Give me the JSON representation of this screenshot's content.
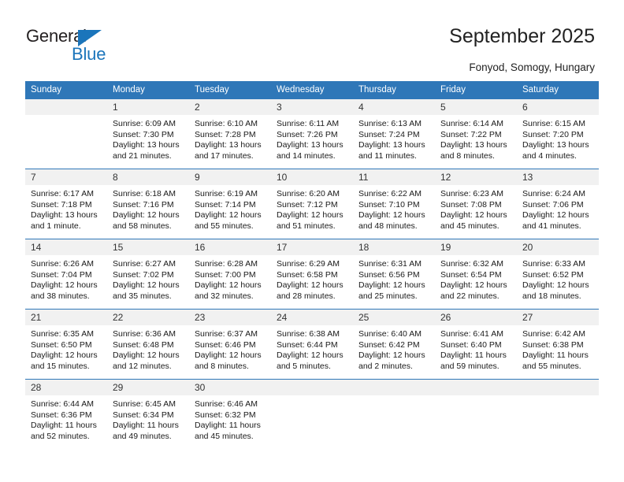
{
  "brand": {
    "name_part1": "General",
    "name_part2": "Blue",
    "triangle_color": "#1b75bb",
    "text_color": "#231f20"
  },
  "header": {
    "title": "September 2025",
    "subtitle": "Fonyod, Somogy, Hungary"
  },
  "theme": {
    "header_blue": "#2f77b8",
    "daynum_band": "#f1f1f1",
    "text": "#1a1a1a"
  },
  "weekday_headers": [
    "Sunday",
    "Monday",
    "Tuesday",
    "Wednesday",
    "Thursday",
    "Friday",
    "Saturday"
  ],
  "weeks": [
    [
      {
        "day": "",
        "sunrise": "",
        "sunset": "",
        "daylight1": "",
        "daylight2": "",
        "blank": true
      },
      {
        "day": "1",
        "sunrise": "Sunrise: 6:09 AM",
        "sunset": "Sunset: 7:30 PM",
        "daylight1": "Daylight: 13 hours",
        "daylight2": "and 21 minutes."
      },
      {
        "day": "2",
        "sunrise": "Sunrise: 6:10 AM",
        "sunset": "Sunset: 7:28 PM",
        "daylight1": "Daylight: 13 hours",
        "daylight2": "and 17 minutes."
      },
      {
        "day": "3",
        "sunrise": "Sunrise: 6:11 AM",
        "sunset": "Sunset: 7:26 PM",
        "daylight1": "Daylight: 13 hours",
        "daylight2": "and 14 minutes."
      },
      {
        "day": "4",
        "sunrise": "Sunrise: 6:13 AM",
        "sunset": "Sunset: 7:24 PM",
        "daylight1": "Daylight: 13 hours",
        "daylight2": "and 11 minutes."
      },
      {
        "day": "5",
        "sunrise": "Sunrise: 6:14 AM",
        "sunset": "Sunset: 7:22 PM",
        "daylight1": "Daylight: 13 hours",
        "daylight2": "and 8 minutes."
      },
      {
        "day": "6",
        "sunrise": "Sunrise: 6:15 AM",
        "sunset": "Sunset: 7:20 PM",
        "daylight1": "Daylight: 13 hours",
        "daylight2": "and 4 minutes."
      }
    ],
    [
      {
        "day": "7",
        "sunrise": "Sunrise: 6:17 AM",
        "sunset": "Sunset: 7:18 PM",
        "daylight1": "Daylight: 13 hours",
        "daylight2": "and 1 minute."
      },
      {
        "day": "8",
        "sunrise": "Sunrise: 6:18 AM",
        "sunset": "Sunset: 7:16 PM",
        "daylight1": "Daylight: 12 hours",
        "daylight2": "and 58 minutes."
      },
      {
        "day": "9",
        "sunrise": "Sunrise: 6:19 AM",
        "sunset": "Sunset: 7:14 PM",
        "daylight1": "Daylight: 12 hours",
        "daylight2": "and 55 minutes."
      },
      {
        "day": "10",
        "sunrise": "Sunrise: 6:20 AM",
        "sunset": "Sunset: 7:12 PM",
        "daylight1": "Daylight: 12 hours",
        "daylight2": "and 51 minutes."
      },
      {
        "day": "11",
        "sunrise": "Sunrise: 6:22 AM",
        "sunset": "Sunset: 7:10 PM",
        "daylight1": "Daylight: 12 hours",
        "daylight2": "and 48 minutes."
      },
      {
        "day": "12",
        "sunrise": "Sunrise: 6:23 AM",
        "sunset": "Sunset: 7:08 PM",
        "daylight1": "Daylight: 12 hours",
        "daylight2": "and 45 minutes."
      },
      {
        "day": "13",
        "sunrise": "Sunrise: 6:24 AM",
        "sunset": "Sunset: 7:06 PM",
        "daylight1": "Daylight: 12 hours",
        "daylight2": "and 41 minutes."
      }
    ],
    [
      {
        "day": "14",
        "sunrise": "Sunrise: 6:26 AM",
        "sunset": "Sunset: 7:04 PM",
        "daylight1": "Daylight: 12 hours",
        "daylight2": "and 38 minutes."
      },
      {
        "day": "15",
        "sunrise": "Sunrise: 6:27 AM",
        "sunset": "Sunset: 7:02 PM",
        "daylight1": "Daylight: 12 hours",
        "daylight2": "and 35 minutes."
      },
      {
        "day": "16",
        "sunrise": "Sunrise: 6:28 AM",
        "sunset": "Sunset: 7:00 PM",
        "daylight1": "Daylight: 12 hours",
        "daylight2": "and 32 minutes."
      },
      {
        "day": "17",
        "sunrise": "Sunrise: 6:29 AM",
        "sunset": "Sunset: 6:58 PM",
        "daylight1": "Daylight: 12 hours",
        "daylight2": "and 28 minutes."
      },
      {
        "day": "18",
        "sunrise": "Sunrise: 6:31 AM",
        "sunset": "Sunset: 6:56 PM",
        "daylight1": "Daylight: 12 hours",
        "daylight2": "and 25 minutes."
      },
      {
        "day": "19",
        "sunrise": "Sunrise: 6:32 AM",
        "sunset": "Sunset: 6:54 PM",
        "daylight1": "Daylight: 12 hours",
        "daylight2": "and 22 minutes."
      },
      {
        "day": "20",
        "sunrise": "Sunrise: 6:33 AM",
        "sunset": "Sunset: 6:52 PM",
        "daylight1": "Daylight: 12 hours",
        "daylight2": "and 18 minutes."
      }
    ],
    [
      {
        "day": "21",
        "sunrise": "Sunrise: 6:35 AM",
        "sunset": "Sunset: 6:50 PM",
        "daylight1": "Daylight: 12 hours",
        "daylight2": "and 15 minutes."
      },
      {
        "day": "22",
        "sunrise": "Sunrise: 6:36 AM",
        "sunset": "Sunset: 6:48 PM",
        "daylight1": "Daylight: 12 hours",
        "daylight2": "and 12 minutes."
      },
      {
        "day": "23",
        "sunrise": "Sunrise: 6:37 AM",
        "sunset": "Sunset: 6:46 PM",
        "daylight1": "Daylight: 12 hours",
        "daylight2": "and 8 minutes."
      },
      {
        "day": "24",
        "sunrise": "Sunrise: 6:38 AM",
        "sunset": "Sunset: 6:44 PM",
        "daylight1": "Daylight: 12 hours",
        "daylight2": "and 5 minutes."
      },
      {
        "day": "25",
        "sunrise": "Sunrise: 6:40 AM",
        "sunset": "Sunset: 6:42 PM",
        "daylight1": "Daylight: 12 hours",
        "daylight2": "and 2 minutes."
      },
      {
        "day": "26",
        "sunrise": "Sunrise: 6:41 AM",
        "sunset": "Sunset: 6:40 PM",
        "daylight1": "Daylight: 11 hours",
        "daylight2": "and 59 minutes."
      },
      {
        "day": "27",
        "sunrise": "Sunrise: 6:42 AM",
        "sunset": "Sunset: 6:38 PM",
        "daylight1": "Daylight: 11 hours",
        "daylight2": "and 55 minutes."
      }
    ],
    [
      {
        "day": "28",
        "sunrise": "Sunrise: 6:44 AM",
        "sunset": "Sunset: 6:36 PM",
        "daylight1": "Daylight: 11 hours",
        "daylight2": "and 52 minutes."
      },
      {
        "day": "29",
        "sunrise": "Sunrise: 6:45 AM",
        "sunset": "Sunset: 6:34 PM",
        "daylight1": "Daylight: 11 hours",
        "daylight2": "and 49 minutes."
      },
      {
        "day": "30",
        "sunrise": "Sunrise: 6:46 AM",
        "sunset": "Sunset: 6:32 PM",
        "daylight1": "Daylight: 11 hours",
        "daylight2": "and 45 minutes."
      },
      {
        "day": "",
        "sunrise": "",
        "sunset": "",
        "daylight1": "",
        "daylight2": "",
        "blank": true
      },
      {
        "day": "",
        "sunrise": "",
        "sunset": "",
        "daylight1": "",
        "daylight2": "",
        "blank": true
      },
      {
        "day": "",
        "sunrise": "",
        "sunset": "",
        "daylight1": "",
        "daylight2": "",
        "blank": true
      },
      {
        "day": "",
        "sunrise": "",
        "sunset": "",
        "daylight1": "",
        "daylight2": "",
        "blank": true
      }
    ]
  ]
}
